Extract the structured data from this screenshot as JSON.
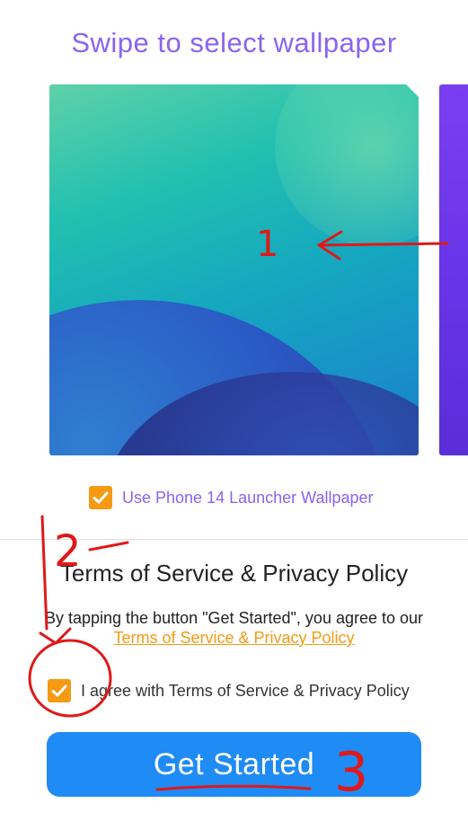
{
  "header": {
    "title": "Swipe to select wallpaper"
  },
  "wallpaper": {
    "option": {
      "label": "Use Phone 14 Launcher Wallpaper",
      "checked": true
    }
  },
  "terms": {
    "title": "Terms of Service & Privacy Policy",
    "text": "By tapping the button \"Get Started\", you agree to our",
    "link": "Terms of Service & Privacy Policy",
    "agree": {
      "label": "I agree with Terms of Service & Privacy Policy",
      "checked": true
    }
  },
  "cta": {
    "label": "Get Started"
  },
  "annotations": {
    "mark1": "1",
    "mark2": "2",
    "mark3": "3"
  },
  "colors": {
    "accent": "#8a63f0",
    "checkbox": "#f59a12",
    "button": "#1f8bf5",
    "annotation": "#e01818"
  }
}
